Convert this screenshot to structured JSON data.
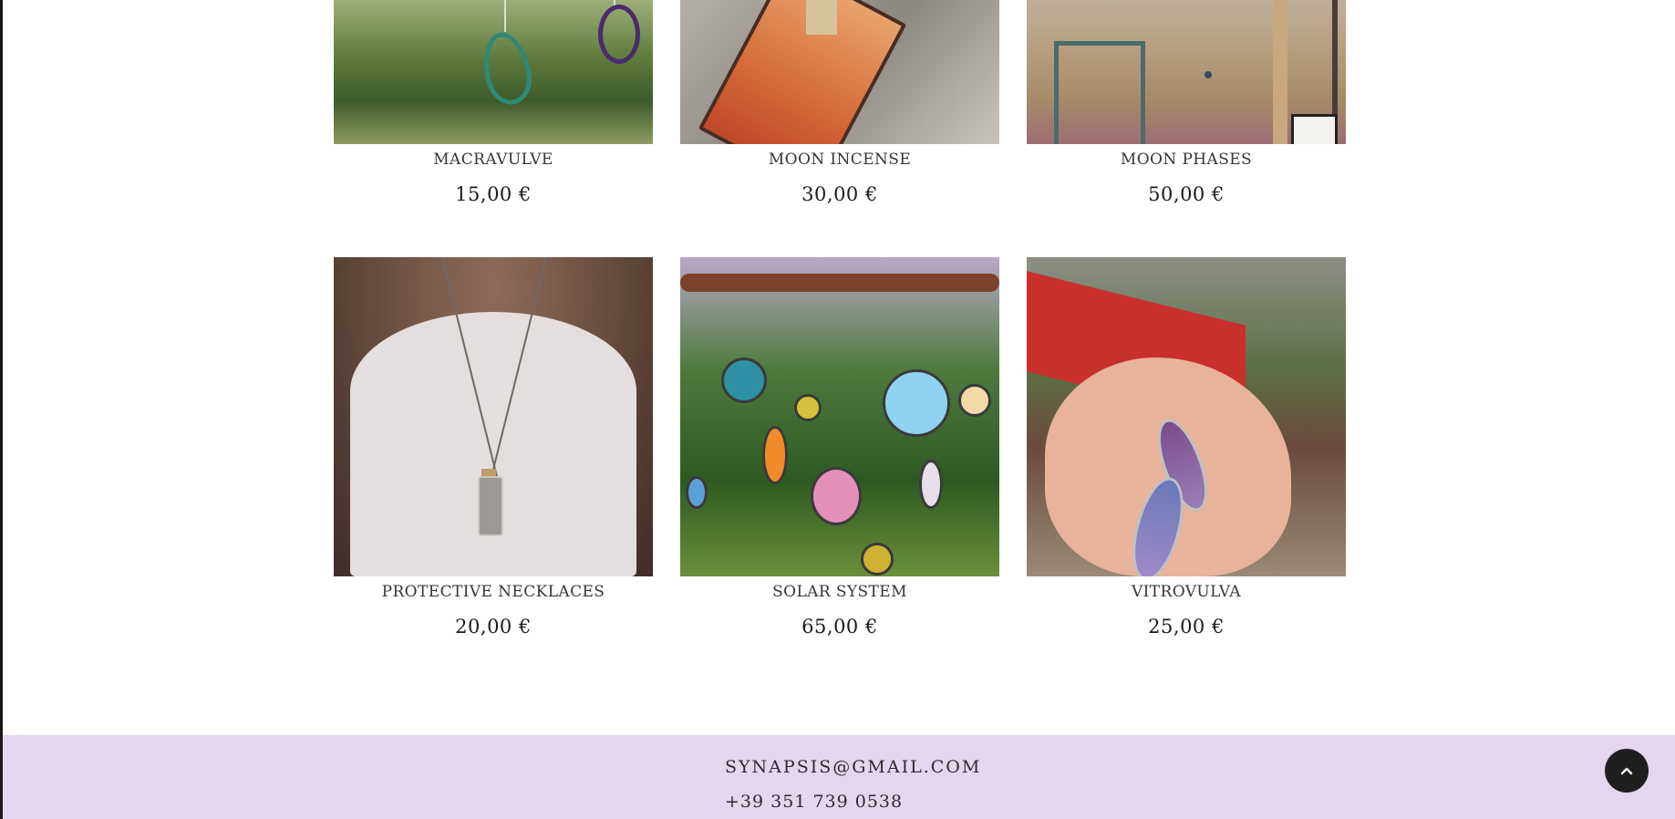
{
  "products": [
    {
      "name": "MACRAVULVE",
      "price": "15,00 €"
    },
    {
      "name": "MOON INCENSE",
      "price": "30,00 €"
    },
    {
      "name": "MOON PHASES",
      "price": "50,00 €"
    },
    {
      "name": "PROTECTIVE NECKLACES",
      "price": "20,00 €"
    },
    {
      "name": "SOLAR SYSTEM",
      "price": "65,00 €"
    },
    {
      "name": "VITROVULVA",
      "price": "25,00 €"
    }
  ],
  "footer": {
    "email": "SYNAPSIS@GMAIL.COM",
    "phone": "+39 351 739 0538"
  },
  "icons": {
    "back_to_top": "chevron-up-icon"
  },
  "colors": {
    "footer_bg": "#e4d6ec",
    "button_bg": "#1f1f1f"
  }
}
